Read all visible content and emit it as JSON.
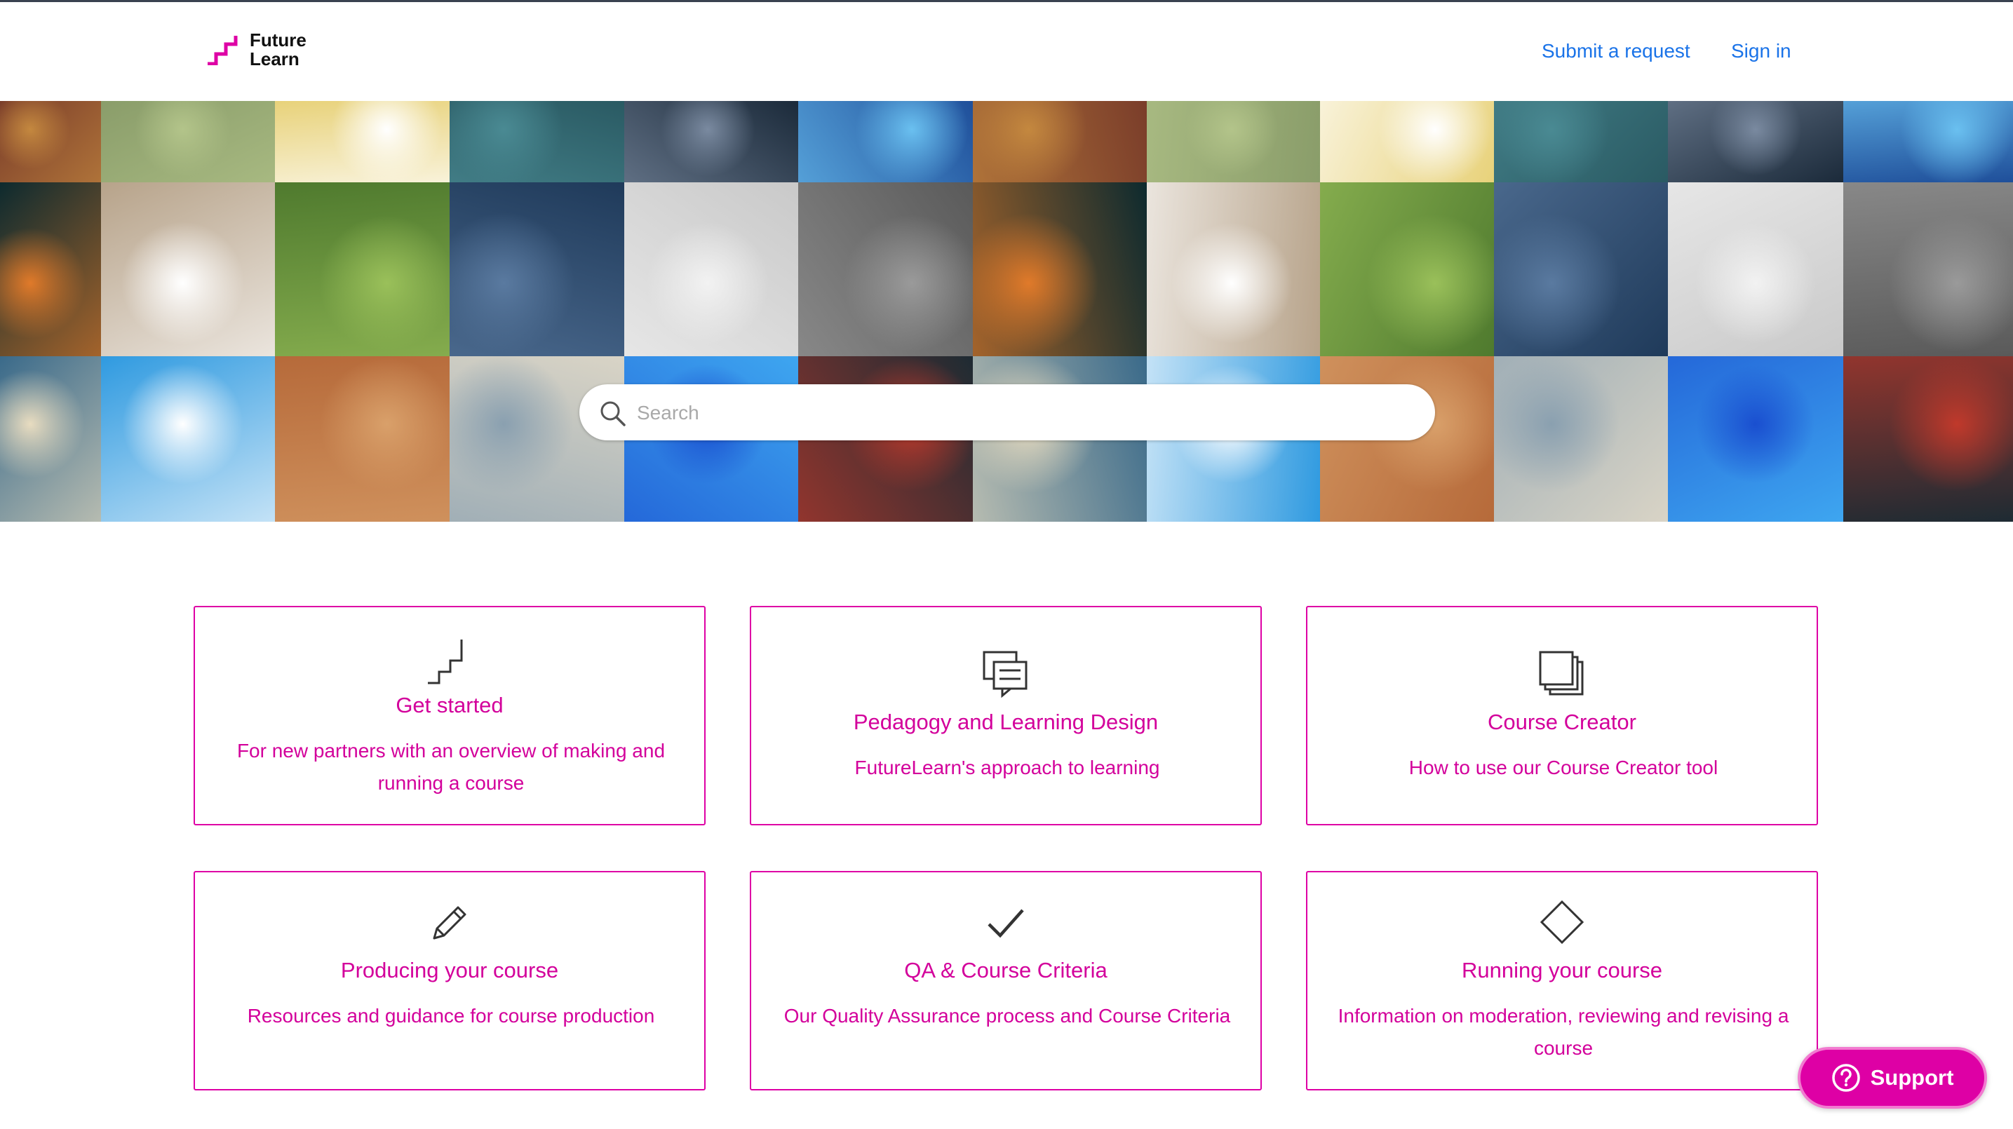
{
  "header": {
    "logo_line1": "Future",
    "logo_line2": "Learn",
    "nav_submit": "Submit a request",
    "nav_signin": "Sign in"
  },
  "search": {
    "placeholder": "Search"
  },
  "cards": [
    {
      "title": "Get started",
      "description": "For new partners with an overview of making and running a course",
      "icon": "steps-icon"
    },
    {
      "title": "Pedagogy and Learning Design",
      "description": "FutureLearn's approach to learning",
      "icon": "chat-frames-icon"
    },
    {
      "title": "Course Creator",
      "description": "How to use our Course Creator tool",
      "icon": "stacked-pages-icon"
    },
    {
      "title": "Producing your course",
      "description": "Resources and guidance for course production",
      "icon": "pencil-icon"
    },
    {
      "title": "QA & Course Criteria",
      "description": "Our Quality Assurance process and Course Criteria",
      "icon": "checkmark-icon"
    },
    {
      "title": "Running your course",
      "description": "Information on moderation, reviewing and revising a course",
      "icon": "diamond-icon"
    }
  ],
  "support": {
    "label": "Support",
    "icon": "question-icon"
  },
  "colors": {
    "accent": "#de00a5",
    "link": "#1a73e8"
  }
}
